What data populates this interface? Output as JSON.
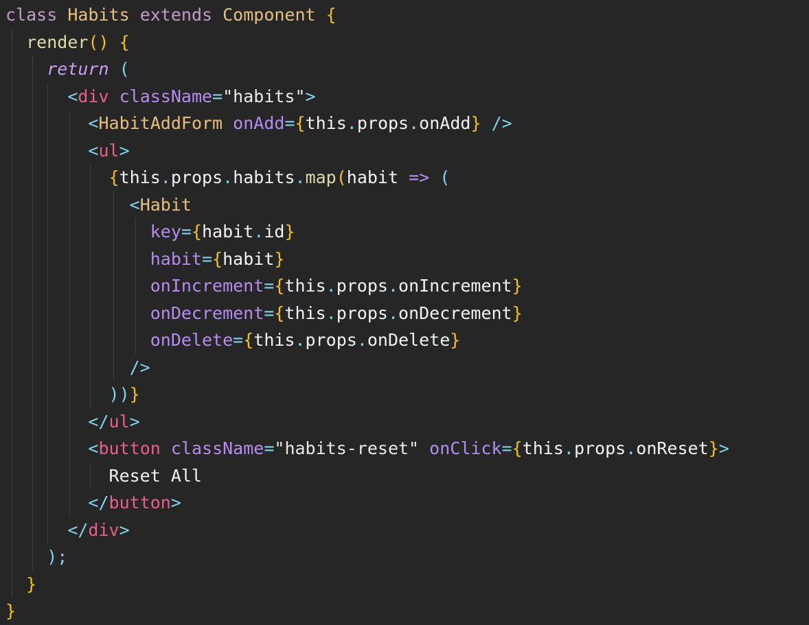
{
  "theme": {
    "background": "#262626",
    "keyword": "#c39ac9",
    "class_name": "#e5c07b",
    "bracket": "#f1c40f",
    "tag": "#ec5f8c",
    "attribute": "#b58cf0",
    "punctuation": "#7fd6ec",
    "text": "#f2f2f2"
  },
  "code": {
    "l1": {
      "kw": "class",
      "name": "Habits",
      "ext": "extends",
      "base": "Component",
      "open": "{"
    },
    "l2": {
      "fn": "render",
      "parens": "()",
      "open": "{"
    },
    "l3": {
      "kw": "return",
      "paren": "("
    },
    "l4": {
      "lt": "<",
      "tag": "div",
      "attr": "className",
      "eq": "=",
      "val": "\"habits\"",
      "gt": ">"
    },
    "l5": {
      "lt": "<",
      "tag": "HabitAddForm",
      "attr": "onAdd",
      "eq": "=",
      "ob": "{",
      "this": "this",
      "dot1": ".",
      "props": "props",
      "dot2": ".",
      "prop": "onAdd",
      "cb": "}",
      "close": "/>"
    },
    "l6": {
      "lt": "<",
      "tag": "ul",
      "gt": ">"
    },
    "l7": {
      "ob": "{",
      "this": "this",
      "dot1": ".",
      "props": "props",
      "dot2": ".",
      "habits": "habits",
      "dot3": ".",
      "map": "map",
      "op": "(",
      "arg": "habit",
      "arrow": "=>",
      "po": "("
    },
    "l8": {
      "lt": "<",
      "tag": "Habit"
    },
    "l9": {
      "attr": "key",
      "eq": "=",
      "ob": "{",
      "obj": "habit",
      "dot": ".",
      "prop": "id",
      "cb": "}"
    },
    "l10": {
      "attr": "habit",
      "eq": "=",
      "ob": "{",
      "val": "habit",
      "cb": "}"
    },
    "l11": {
      "attr": "onIncrement",
      "eq": "=",
      "ob": "{",
      "this": "this",
      "dot1": ".",
      "props": "props",
      "dot2": ".",
      "prop": "onIncrement",
      "cb": "}"
    },
    "l12": {
      "attr": "onDecrement",
      "eq": "=",
      "ob": "{",
      "this": "this",
      "dot1": ".",
      "props": "props",
      "dot2": ".",
      "prop": "onDecrement",
      "cb": "}"
    },
    "l13": {
      "attr": "onDelete",
      "eq": "=",
      "ob": "{",
      "this": "this",
      "dot1": ".",
      "props": "props",
      "dot2": ".",
      "prop": "onDelete",
      "cb": "}"
    },
    "l14": {
      "close": "/>"
    },
    "l15": {
      "parens": "))",
      "cb": "}"
    },
    "l16": {
      "lt": "</",
      "tag": "ul",
      "gt": ">"
    },
    "l17": {
      "lt": "<",
      "tag": "button",
      "attr1": "className",
      "eq1": "=",
      "val": "\"habits-reset\"",
      "attr2": "onClick",
      "eq2": "=",
      "ob": "{",
      "this": "this",
      "dot1": ".",
      "props": "props",
      "dot2": ".",
      "prop": "onReset",
      "cb": "}",
      "gt": ">"
    },
    "l18": {
      "text": "Reset All"
    },
    "l19": {
      "lt": "</",
      "tag": "button",
      "gt": ">"
    },
    "l20": {
      "lt": "</",
      "tag": "div",
      "gt": ">"
    },
    "l21": {
      "close": ");"
    },
    "l22": {
      "cb": "}"
    },
    "l23": {
      "cb": "}"
    }
  }
}
